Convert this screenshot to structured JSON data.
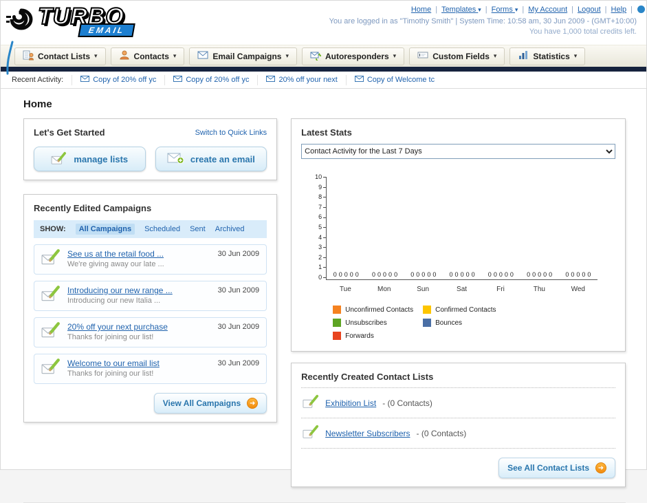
{
  "icons": {
    "chevron_down": "▾",
    "arrow_right": "➜"
  },
  "header": {
    "logo_text": "TURBO",
    "logo_sub": "EMAIL",
    "links": {
      "home": "Home",
      "templates": "Templates",
      "forms": "Forms",
      "my_account": "My Account",
      "logout": "Logout",
      "help": "Help"
    },
    "session_line": "You are logged in as \"Timothy Smith\" | System Time: 10:58 am, 30 Jun 2009 - (GMT+10:00)",
    "credits_line": "You have 1,000 total credits left."
  },
  "nav_tabs": [
    {
      "label": "Contact Lists"
    },
    {
      "label": "Contacts"
    },
    {
      "label": "Email Campaigns"
    },
    {
      "label": "Autoresponders"
    },
    {
      "label": "Custom Fields"
    },
    {
      "label": "Statistics"
    }
  ],
  "recent_activity": {
    "label": "Recent Activity:",
    "items": [
      {
        "label": "Copy of 20% off yc"
      },
      {
        "label": "Copy of 20% off yc"
      },
      {
        "label": "20% off your next"
      },
      {
        "label": "Copy of Welcome tc"
      }
    ]
  },
  "page_title": "Home",
  "get_started": {
    "title": "Let's Get Started",
    "switch_link": "Switch to Quick Links",
    "manage_lists_label": "manage lists",
    "create_email_label": "create an email"
  },
  "campaigns": {
    "title": "Recently Edited Campaigns",
    "show_label": "SHOW:",
    "filters": [
      {
        "label": "All Campaigns"
      },
      {
        "label": "Scheduled"
      },
      {
        "label": "Sent"
      },
      {
        "label": "Archived"
      }
    ],
    "items": [
      {
        "title": "See us at the retail food ...",
        "subtitle": "We're giving away our late ...",
        "date": "30 Jun 2009"
      },
      {
        "title": "Introducing our new range ...",
        "subtitle": "Introducing our new Italia ...",
        "date": "30 Jun 2009"
      },
      {
        "title": "20% off your next purchase",
        "subtitle": "Thanks for joining our list!",
        "date": "30 Jun 2009"
      },
      {
        "title": "Welcome to our email list",
        "subtitle": "Thanks for joining our list!",
        "date": "30 Jun 2009"
      }
    ],
    "view_all_label": "View All Campaigns"
  },
  "latest_stats": {
    "title": "Latest Stats",
    "selected_option": "Contact Activity for the Last 7 Days",
    "chart_data": {
      "type": "bar",
      "title": "Contact Activity for the Last 7 Days",
      "categories": [
        "Tue",
        "Mon",
        "Sun",
        "Sat",
        "Fri",
        "Thu",
        "Wed"
      ],
      "series": [
        {
          "name": "Unconfirmed Contacts",
          "color": "#f58220",
          "values": [
            0,
            0,
            0,
            0,
            0,
            0,
            0
          ]
        },
        {
          "name": "Confirmed Contacts",
          "color": "#fdc500",
          "values": [
            0,
            0,
            0,
            0,
            0,
            0,
            0
          ]
        },
        {
          "name": "Unsubscribes",
          "color": "#5da423",
          "values": [
            0,
            0,
            0,
            0,
            0,
            0,
            0
          ]
        },
        {
          "name": "Bounces",
          "color": "#4a6fa5",
          "values": [
            0,
            0,
            0,
            0,
            0,
            0,
            0
          ]
        },
        {
          "name": "Forwards",
          "color": "#e8441f",
          "values": [
            0,
            0,
            0,
            0,
            0,
            0,
            0
          ]
        }
      ],
      "ylim": [
        0,
        10
      ],
      "yticks": [
        0,
        1,
        2,
        3,
        4,
        5,
        6,
        7,
        8,
        9,
        10
      ],
      "grid": false,
      "legend_position": "bottom"
    }
  },
  "contact_lists": {
    "title": "Recently Created Contact Lists",
    "items": [
      {
        "name": "Exhibition List",
        "detail": "- (0 Contacts)"
      },
      {
        "name": "Newsletter Subscribers",
        "detail": "- (0 Contacts)"
      }
    ],
    "see_all_label": "See All Contact Lists"
  },
  "colors": {
    "navy_bar": "#16233e",
    "link_blue": "#1f62ad",
    "accent_orange": "#f7941e"
  }
}
